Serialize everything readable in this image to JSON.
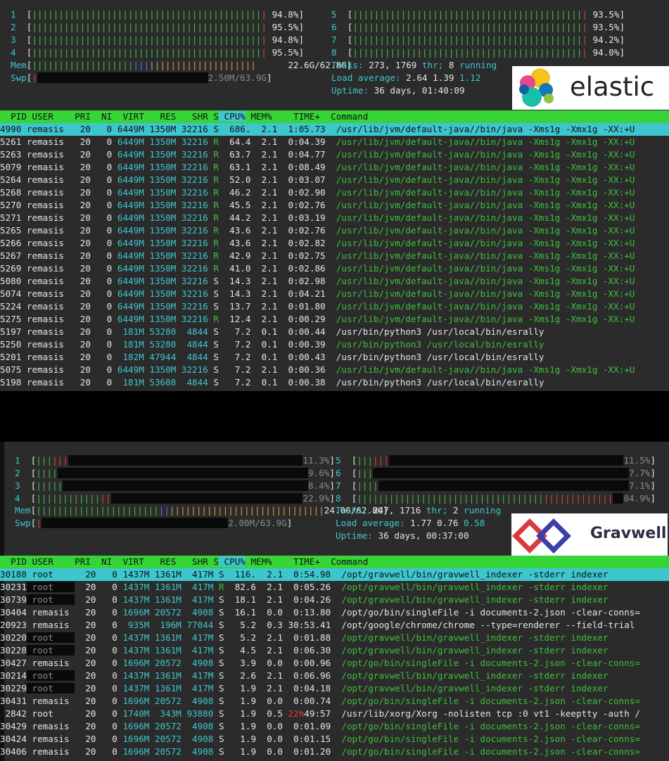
{
  "top": {
    "cpus_left": [
      {
        "n": "1",
        "pct": "94.8%"
      },
      {
        "n": "2",
        "pct": "95.5%"
      },
      {
        "n": "3",
        "pct": "94.8%"
      },
      {
        "n": "4",
        "pct": "95.5%"
      }
    ],
    "cpus_right": [
      {
        "n": "5",
        "pct": "93.5%"
      },
      {
        "n": "6",
        "pct": "93.5%"
      },
      {
        "n": "7",
        "pct": "94.2%"
      },
      {
        "n": "8",
        "pct": "94.0%"
      }
    ],
    "mem_label": "Mem",
    "mem_value": "22.6G/62.8G",
    "swp_label": "Swp",
    "swp_value": "2.50M/63.9G",
    "tasks_label": "Tasks:",
    "tasks_count": "273,",
    "threads": "1769",
    "thr_label": "thr;",
    "running": "8",
    "running_label": "running",
    "load_label": "Load average:",
    "load1": "2.64",
    "load5": "1.39",
    "load15": "1.12",
    "uptime_label": "Uptime:",
    "uptime": "36 days, 01:40:09",
    "logo_text": "elastic",
    "columns": [
      "PID",
      "USER",
      "PRI",
      "NI",
      "VIRT",
      "RES",
      "SHR",
      "S",
      "CPU%",
      "MEM%",
      "TIME+",
      "Command"
    ],
    "rows": [
      [
        "4990",
        "remasis",
        "20",
        "0",
        "6449M",
        "1350M",
        "32216",
        "S",
        "686.",
        "2.1",
        "1:05.73",
        "/usr/lib/jvm/default-java//bin/java -Xms1g -Xmx1g -XX:+U"
      ],
      [
        "5261",
        "remasis",
        "20",
        "0",
        "6449M",
        "1350M",
        "32216",
        "R",
        "64.4",
        "2.1",
        "0:04.39",
        "/usr/lib/jvm/default-java//bin/java -Xms1g -Xmx1g -XX:+U"
      ],
      [
        "5263",
        "remasis",
        "20",
        "0",
        "6449M",
        "1350M",
        "32216",
        "R",
        "63.7",
        "2.1",
        "0:04.77",
        "/usr/lib/jvm/default-java//bin/java -Xms1g -Xmx1g -XX:+U"
      ],
      [
        "5079",
        "remasis",
        "20",
        "0",
        "6449M",
        "1350M",
        "32216",
        "R",
        "63.1",
        "2.1",
        "0:08.49",
        "/usr/lib/jvm/default-java//bin/java -Xms1g -Xmx1g -XX:+U"
      ],
      [
        "5264",
        "remasis",
        "20",
        "0",
        "6449M",
        "1350M",
        "32216",
        "R",
        "52.0",
        "2.1",
        "0:03.07",
        "/usr/lib/jvm/default-java//bin/java -Xms1g -Xmx1g -XX:+U"
      ],
      [
        "5268",
        "remasis",
        "20",
        "0",
        "6449M",
        "1350M",
        "32216",
        "R",
        "46.2",
        "2.1",
        "0:02.90",
        "/usr/lib/jvm/default-java//bin/java -Xms1g -Xmx1g -XX:+U"
      ],
      [
        "5270",
        "remasis",
        "20",
        "0",
        "6449M",
        "1350M",
        "32216",
        "R",
        "45.5",
        "2.1",
        "0:02.76",
        "/usr/lib/jvm/default-java//bin/java -Xms1g -Xmx1g -XX:+U"
      ],
      [
        "5271",
        "remasis",
        "20",
        "0",
        "6449M",
        "1350M",
        "32216",
        "R",
        "44.2",
        "2.1",
        "0:03.19",
        "/usr/lib/jvm/default-java//bin/java -Xms1g -Xmx1g -XX:+U"
      ],
      [
        "5265",
        "remasis",
        "20",
        "0",
        "6449M",
        "1350M",
        "32216",
        "R",
        "43.6",
        "2.1",
        "0:02.76",
        "/usr/lib/jvm/default-java//bin/java -Xms1g -Xmx1g -XX:+U"
      ],
      [
        "5266",
        "remasis",
        "20",
        "0",
        "6449M",
        "1350M",
        "32216",
        "R",
        "43.6",
        "2.1",
        "0:02.82",
        "/usr/lib/jvm/default-java//bin/java -Xms1g -Xmx1g -XX:+U"
      ],
      [
        "5267",
        "remasis",
        "20",
        "0",
        "6449M",
        "1350M",
        "32216",
        "R",
        "42.9",
        "2.1",
        "0:02.75",
        "/usr/lib/jvm/default-java//bin/java -Xms1g -Xmx1g -XX:+U"
      ],
      [
        "5269",
        "remasis",
        "20",
        "0",
        "6449M",
        "1350M",
        "32216",
        "R",
        "41.0",
        "2.1",
        "0:02.86",
        "/usr/lib/jvm/default-java//bin/java -Xms1g -Xmx1g -XX:+U"
      ],
      [
        "5080",
        "remasis",
        "20",
        "0",
        "6449M",
        "1350M",
        "32216",
        "S",
        "14.3",
        "2.1",
        "0:02.98",
        "/usr/lib/jvm/default-java//bin/java -Xms1g -Xmx1g -XX:+U"
      ],
      [
        "5074",
        "remasis",
        "20",
        "0",
        "6449M",
        "1350M",
        "32216",
        "S",
        "14.3",
        "2.1",
        "0:04.21",
        "/usr/lib/jvm/default-java//bin/java -Xms1g -Xmx1g -XX:+U"
      ],
      [
        "5224",
        "remasis",
        "20",
        "0",
        "6449M",
        "1350M",
        "32216",
        "S",
        "13.7",
        "2.1",
        "0:01.80",
        "/usr/lib/jvm/default-java//bin/java -Xms1g -Xmx1g -XX:+U"
      ],
      [
        "5275",
        "remasis",
        "20",
        "0",
        "6449M",
        "1350M",
        "32216",
        "R",
        "12.4",
        "2.1",
        "0:00.29",
        "/usr/lib/jvm/default-java//bin/java -Xms1g -Xmx1g -XX:+U"
      ],
      [
        "5197",
        "remasis",
        "20",
        "0",
        "181M",
        "53280",
        "4844",
        "S",
        "7.2",
        "0.1",
        "0:00.44",
        "/usr/bin/python3 /usr/local/bin/esrally"
      ],
      [
        "5250",
        "remasis",
        "20",
        "0",
        "181M",
        "53280",
        "4844",
        "S",
        "7.2",
        "0.1",
        "0:00.39",
        "/usr/bin/python3 /usr/local/bin/esrally"
      ],
      [
        "5201",
        "remasis",
        "20",
        "0",
        "182M",
        "47944",
        "4844",
        "S",
        "7.2",
        "0.1",
        "0:00.43",
        "/usr/bin/python3 /usr/local/bin/esrally"
      ],
      [
        "5075",
        "remasis",
        "20",
        "0",
        "6449M",
        "1350M",
        "32216",
        "S",
        "7.2",
        "2.1",
        "0:00.36",
        "/usr/lib/jvm/default-java//bin/java -Xms1g -Xmx1g -XX:+U"
      ],
      [
        "5198",
        "remasis",
        "20",
        "0",
        "181M",
        "53608",
        "4844",
        "S",
        "7.2",
        "0.1",
        "0:00.38",
        "/usr/bin/python3 /usr/local/bin/esrally"
      ]
    ],
    "row_cmd_green": [
      false,
      true,
      true,
      true,
      true,
      true,
      true,
      true,
      true,
      true,
      true,
      true,
      true,
      true,
      true,
      true,
      false,
      true,
      false,
      true,
      false
    ]
  },
  "bottom": {
    "cpus_left": [
      {
        "n": "1",
        "pct": "11.3%"
      },
      {
        "n": "2",
        "pct": "9.6%"
      },
      {
        "n": "3",
        "pct": "8.4%"
      },
      {
        "n": "4",
        "pct": "22.9%"
      }
    ],
    "cpus_right": [
      {
        "n": "5",
        "pct": "11.5%"
      },
      {
        "n": "6",
        "pct": "7.7%"
      },
      {
        "n": "7",
        "pct": "7.1%"
      },
      {
        "n": "8",
        "pct": "84.9%"
      }
    ],
    "mem_label": "Mem",
    "mem_value": "24.0G/62.8G",
    "swp_label": "Swp",
    "swp_value": "2.00M/63.9G",
    "tasks_label": "Tasks:",
    "tasks_count": "247,",
    "threads": "1716",
    "thr_label": "thr;",
    "running": "2",
    "running_label": "running",
    "load_label": "Load average:",
    "load1": "1.77",
    "load5": "0.76",
    "load15": "0.58",
    "uptime_label": "Uptime:",
    "uptime": "36 days, 00:37:00",
    "logo_text": "Gravwell",
    "columns": [
      "PID",
      "USER",
      "PRI",
      "NI",
      "VIRT",
      "RES",
      "SHR",
      "S",
      "CPU%",
      "MEM%",
      "TIME+",
      "Command"
    ],
    "rows": [
      [
        "30188",
        "root",
        "20",
        "0",
        "1437M",
        "1361M",
        "417M",
        "S",
        "116.",
        "2.1",
        "0:54.98",
        "/opt/gravwell/bin/gravwell_indexer -stderr indexer"
      ],
      [
        "30231",
        "root",
        "20",
        "0",
        "1437M",
        "1361M",
        "417M",
        "R",
        "82.6",
        "2.1",
        "0:05.26",
        "/opt/gravwell/bin/gravwell_indexer -stderr indexer"
      ],
      [
        "30739",
        "root",
        "20",
        "0",
        "1437M",
        "1361M",
        "417M",
        "S",
        "18.1",
        "2.1",
        "0:04.26",
        "/opt/gravwell/bin/gravwell_indexer -stderr indexer"
      ],
      [
        "30404",
        "remasis",
        "20",
        "0",
        "1696M",
        "20572",
        "4908",
        "S",
        "16.1",
        "0.0",
        "0:13.80",
        "/opt/go/bin/singleFile -i documents-2.json -clear-conns="
      ],
      [
        "20923",
        "remasis",
        "20",
        "0",
        "935M",
        "196M",
        "77044",
        "S",
        "5.2",
        "0.3",
        "30:53.41",
        "/opt/google/chrome/chrome --type=renderer --field-trial"
      ],
      [
        "30220",
        "root",
        "20",
        "0",
        "1437M",
        "1361M",
        "417M",
        "S",
        "5.2",
        "2.1",
        "0:01.88",
        "/opt/gravwell/bin/gravwell_indexer -stderr indexer"
      ],
      [
        "30228",
        "root",
        "20",
        "0",
        "1437M",
        "1361M",
        "417M",
        "S",
        "4.5",
        "2.1",
        "0:06.30",
        "/opt/gravwell/bin/gravwell_indexer -stderr indexer"
      ],
      [
        "30427",
        "remasis",
        "20",
        "0",
        "1696M",
        "20572",
        "4908",
        "S",
        "3.9",
        "0.0",
        "0:00.96",
        "/opt/go/bin/singleFile -i documents-2.json -clear-conns="
      ],
      [
        "30214",
        "root",
        "20",
        "0",
        "1437M",
        "1361M",
        "417M",
        "S",
        "2.6",
        "2.1",
        "0:06.96",
        "/opt/gravwell/bin/gravwell_indexer -stderr indexer"
      ],
      [
        "30229",
        "root",
        "20",
        "0",
        "1437M",
        "1361M",
        "417M",
        "S",
        "1.9",
        "2.1",
        "0:04.18",
        "/opt/gravwell/bin/gravwell_indexer -stderr indexer"
      ],
      [
        "30431",
        "remasis",
        "20",
        "0",
        "1696M",
        "20572",
        "4908",
        "S",
        "1.9",
        "0.0",
        "0:00.74",
        "/opt/go/bin/singleFile -i documents-2.json -clear-conns="
      ],
      [
        "2842",
        "root",
        "20",
        "0",
        "1740M",
        "343M",
        "93880",
        "S",
        "1.9",
        "0.5",
        "22h49:57",
        "/usr/lib/xorg/Xorg -nolisten tcp :0 vt1 -keeptty -auth /"
      ],
      [
        "30429",
        "remasis",
        "20",
        "0",
        "1696M",
        "20572",
        "4908",
        "S",
        "1.9",
        "0.0",
        "0:01.09",
        "/opt/go/bin/singleFile -i documents-2.json -clear-conns="
      ],
      [
        "30424",
        "remasis",
        "20",
        "0",
        "1696M",
        "20572",
        "4908",
        "S",
        "1.9",
        "0.0",
        "0:01.15",
        "/opt/go/bin/singleFile -i documents-2.json -clear-conns="
      ],
      [
        "30406",
        "remasis",
        "20",
        "0",
        "1696M",
        "20572",
        "4908",
        "S",
        "1.9",
        "0.0",
        "0:01.20",
        "/opt/go/bin/singleFile -i documents-2.json -clear-conns="
      ]
    ],
    "row_cmd_green": [
      false,
      true,
      true,
      false,
      false,
      true,
      true,
      true,
      true,
      true,
      true,
      false,
      true,
      true,
      true
    ],
    "row_root_dark": [
      false,
      true,
      true,
      false,
      false,
      true,
      true,
      false,
      true,
      true,
      false,
      false,
      false,
      false,
      false
    ]
  },
  "colors": {
    "green": "#37d437",
    "cyan": "#3ec6cf",
    "red": "#e04040",
    "bg": "#2b2b2b"
  }
}
